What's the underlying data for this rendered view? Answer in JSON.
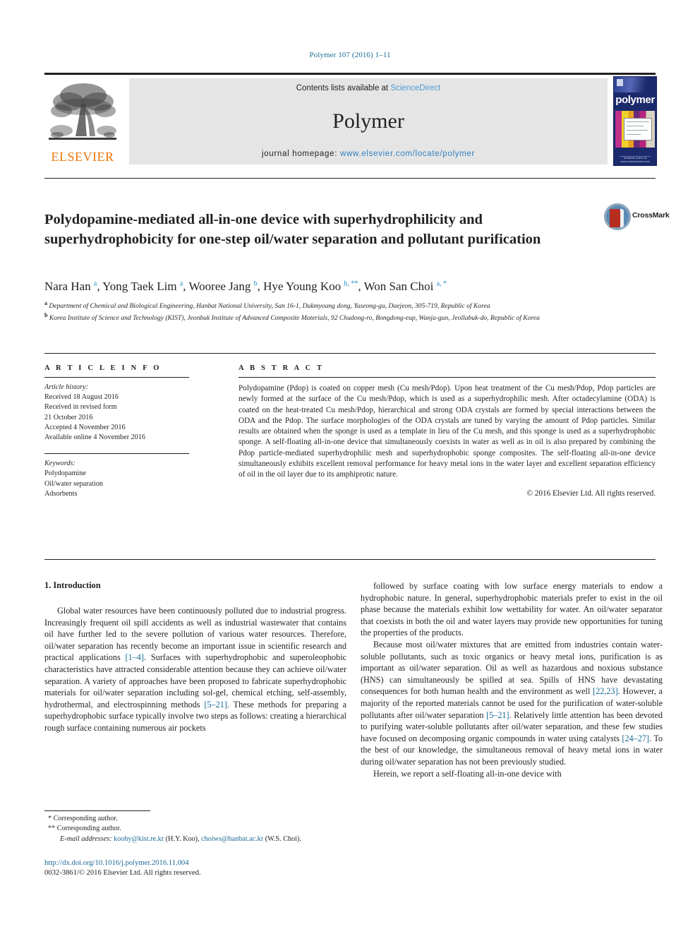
{
  "running_head": "Polymer 107 (2016) 1–11",
  "masthead": {
    "publisher_logo_text": "ELSEVIER",
    "contents_prefix": "Contents lists available at ",
    "contents_link": "ScienceDirect",
    "journal_name": "Polymer",
    "homepage_prefix": "journal homepage: ",
    "homepage_url": "www.elsevier.com/locate/polymer",
    "cover_title": "polymer",
    "cover_footnote": "Available online at www.sciencedirect.com"
  },
  "article": {
    "title": "Polydopamine-mediated all-in-one device with superhydrophilicity and superhydrophobicity for one-step oil/water separation and pollutant purification",
    "crossmark_label": "CrossMark",
    "authors_html": "Nara Han <sup>a</sup>, Yong Taek Lim <sup>a</sup>, Wooree Jang <sup>b</sup>, Hye Young Koo <sup>b, **</sup>, Won San Choi <sup>a, *</sup>",
    "affiliations": [
      {
        "marker": "a",
        "text": "Department of Chemical and Biological Engineering, Hanbat National University, San 16-1, Dukmyoung dong, Yuseong-gu, Daejeon, 305-719, Republic of Korea"
      },
      {
        "marker": "b",
        "text": "Korea Institute of Science and Technology (KIST), Jeonbuk Institute of Advanced Composite Materials, 92 Chudong-ro, Bongdong-eup, Wanju-gun, Jeollabuk-do, Republic of Korea"
      }
    ]
  },
  "article_info": {
    "heading": "A R T I C L E   I N F O",
    "history_label": "Article history:",
    "history": [
      "Received 18 August 2016",
      "Received in revised form",
      "21 October 2016",
      "Accepted 4 November 2016",
      "Available online 4 November 2016"
    ],
    "keywords_label": "Keywords:",
    "keywords": [
      "Polydopamine",
      "Oil/water separation",
      "Adsorbents"
    ]
  },
  "abstract": {
    "heading": "A B S T R A C T",
    "text": "Polydopamine (Pdop) is coated on copper mesh (Cu mesh/Pdop). Upon heat treatment of the Cu mesh/Pdop, Pdop particles are newly formed at the surface of the Cu mesh/Pdop, which is used as a superhydrophilic mesh. After octadecylamine (ODA) is coated on the heat-treated Cu mesh/Pdop, hierarchical and strong ODA crystals are formed by special interactions between the ODA and the Pdop. The surface morphologies of the ODA crystals are tuned by varying the amount of Pdop particles. Similar results are obtained when the sponge is used as a template in lieu of the Cu mesh, and this sponge is used as a superhydrophobic sponge. A self-floating all-in-one device that simultaneously coexists in water as well as in oil is also prepared by combining the Pdop particle-mediated superhydrophilic mesh and superhydrophobic sponge composites. The self-floating all-in-one device simultaneously exhibits excellent removal performance for heavy metal ions in the water layer and excellent separation efficiency of oil in the oil layer due to its amphiprotic nature.",
    "copyright": "© 2016 Elsevier Ltd. All rights reserved."
  },
  "body": {
    "section_heading": "1. Introduction",
    "left_paragraph_1_a": "Global water resources have been continuously polluted due to industrial progress. Increasingly frequent oil spill accidents as well as industrial wastewater that contains oil have further led to the severe pollution of various water resources. Therefore, oil/water separation has recently become an important issue in scientific research and practical applications ",
    "left_ref_1": "[1–4]",
    "left_paragraph_1_b": ". Surfaces with superhydrophobic and superoleophobic characteristics have attracted considerable attention because they can achieve oil/water separation. A variety of approaches have been proposed to fabricate superhydrophobic materials for oil/water separation including sol-gel, chemical etching, self-assembly, hydrothermal, and electrospinning methods ",
    "left_ref_2": "[5–21]",
    "left_paragraph_1_c": ". These methods for preparing a superhydrophobic surface typically involve two steps as follows: creating a hierarchical rough surface containing numerous air pockets",
    "right_paragraph_1": "followed by surface coating with low surface energy materials to endow a hydrophobic nature. In general, superhydrophobic materials prefer to exist in the oil phase because the materials exhibit low wettability for water. An oil/water separator that coexists in both the oil and water layers may provide new opportunities for tuning the properties of the products.",
    "right_paragraph_2_a": "Because most oil/water mixtures that are emitted from industries contain water-soluble pollutants, such as toxic organics or heavy metal ions, purification is as important as oil/water separation. Oil as well as hazardous and noxious substance (HNS) can simultaneously be spilled at sea. Spills of HNS have devastating consequences for both human health and the environment as well ",
    "right_ref_1": "[22,23]",
    "right_paragraph_2_b": ". However, a majority of the reported materials cannot be used for the purification of water-soluble pollutants after oil/water separation ",
    "right_ref_2": "[5–21]",
    "right_paragraph_2_c": ". Relatively little attention has been devoted to purifying water-soluble pollutants after oil/water separation, and these few studies have focused on decomposing organic compounds in water using catalysts ",
    "right_ref_3": "[24–27]",
    "right_paragraph_2_d": ". To the best of our knowledge, the simultaneous removal of heavy metal ions in water during oil/water separation has not been previously studied.",
    "right_paragraph_3": "Herein, we report a self-floating all-in-one device with"
  },
  "footnotes": {
    "corresponding_1": "* Corresponding author.",
    "corresponding_2": "** Corresponding author.",
    "emails_label": "E-mail addresses:",
    "email_1": "koohy@kist.re.kr",
    "email_1_owner": "(H.Y. Koo),",
    "email_2": "choiws@hanbat.ac.kr",
    "email_2_owner": "(W.S. Choi)."
  },
  "footer": {
    "doi": "http://dx.doi.org/10.1016/j.polymer.2016.11.004",
    "issn_line": "0032-3861/© 2016 Elsevier Ltd. All rights reserved."
  },
  "colors": {
    "link_blue": "#1a6a96",
    "sciencedirect_blue": "#4a9ad4",
    "homepage_blue": "#2e7fc1",
    "elsevier_orange": "#ec7404",
    "author_sup_blue": "#1a8fc1",
    "text_black": "#231f20",
    "band_grey": "#e5e5e5",
    "cover_navy": "#1b2a6b",
    "crossmark_red": "#b62d20"
  }
}
